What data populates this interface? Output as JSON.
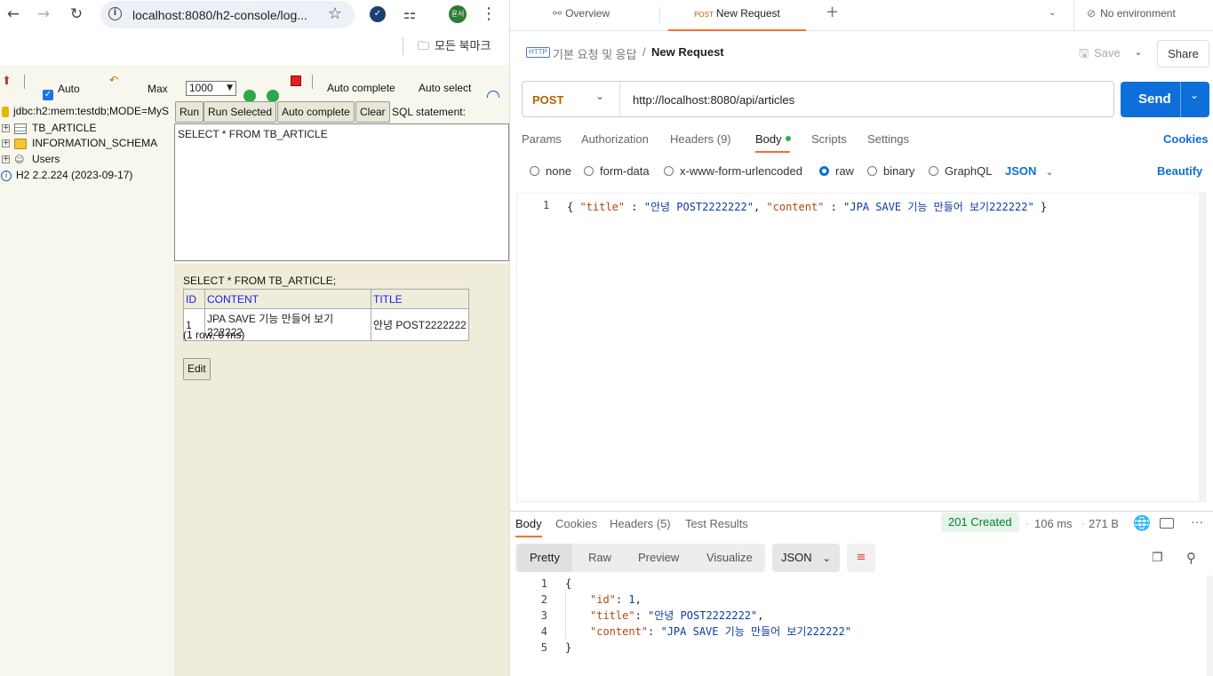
{
  "browser": {
    "url": "localhost:8080/h2-console/log...",
    "profile_initial": "윤서",
    "bookmarks_label": "모든 북마크"
  },
  "h2": {
    "toolbar": {
      "auto_commit_label": "Auto",
      "max_rows_label": "Max",
      "max_rows_value": "1000",
      "auto_complete_label": "Auto complete",
      "auto_select_label": "Auto select"
    },
    "connection": "jdbc:h2:mem:testdb;MODE=MyS",
    "tree": [
      {
        "label": "TB_ARTICLE"
      },
      {
        "label": "INFORMATION_SCHEMA"
      },
      {
        "label": "Users"
      }
    ],
    "version": "H2 2.2.224 (2023-09-17)",
    "buttons": {
      "run": "Run",
      "run_selected": "Run Selected",
      "auto_complete": "Auto complete",
      "clear": "Clear",
      "sql_label": "SQL statement:"
    },
    "sql": "SELECT * FROM TB_ARTICLE",
    "result": {
      "query": "SELECT * FROM TB_ARTICLE;",
      "columns": [
        "ID",
        "CONTENT",
        "TITLE"
      ],
      "rows": [
        [
          "1",
          "JPA SAVE 기능 만들어 보기222222",
          "안녕 POST2222222"
        ]
      ],
      "summary": "(1 row, 0 ms)",
      "edit_label": "Edit"
    }
  },
  "postman": {
    "tabs": {
      "overview": "Overview",
      "request_method": "POST",
      "request_name": "New Request",
      "environment": "No environment"
    },
    "breadcrumb": {
      "collection": "기본 요청 및 응답",
      "separator": "/",
      "request": "New Request",
      "save": "Save",
      "share": "Share"
    },
    "request": {
      "method": "POST",
      "url": "http://localhost:8080/api/articles",
      "send": "Send"
    },
    "param_tabs": {
      "params": "Params",
      "authorization": "Authorization",
      "headers": "Headers (9)",
      "body": "Body",
      "scripts": "Scripts",
      "settings": "Settings",
      "cookies": "Cookies"
    },
    "body_types": {
      "none": "none",
      "form_data": "form-data",
      "urlencoded": "x-www-form-urlencoded",
      "raw": "raw",
      "binary": "binary",
      "graphql": "GraphQL",
      "format": "JSON",
      "beautify": "Beautify"
    },
    "request_body": {
      "line": "1",
      "p1": "{ ",
      "k1": "\"title\"",
      "c1": " : ",
      "v1": "\"안녕 POST2222222\"",
      "c2": ", ",
      "k2": "\"content\"",
      "c3": " : ",
      "v2": "\"JPA SAVE 기능 만들어 보기222222\"",
      "p2": " }"
    },
    "response": {
      "tabs": {
        "body": "Body",
        "cookies": "Cookies",
        "headers": "Headers (5)",
        "test_results": "Test Results"
      },
      "status": "201 Created",
      "time": "106 ms",
      "size": "271 B",
      "views": {
        "pretty": "Pretty",
        "raw": "Raw",
        "preview": "Preview",
        "visualize": "Visualize",
        "format": "JSON"
      },
      "lines": [
        {
          "num": "1",
          "key": "",
          "val": "",
          "text": "{"
        },
        {
          "num": "2",
          "key": "\"id\"",
          "val": "1",
          "text": ","
        },
        {
          "num": "3",
          "key": "\"title\"",
          "val": "\"안녕 POST2222222\"",
          "text": ","
        },
        {
          "num": "4",
          "key": "\"content\"",
          "val": "\"JPA SAVE 기능 만들어 보기222222\"",
          "text": ""
        },
        {
          "num": "5",
          "key": "",
          "val": "",
          "text": "}"
        }
      ]
    }
  },
  "colors": {
    "post_orange": "#b26400",
    "send_blue": "#0e6fda",
    "status_green": "#007f31",
    "string_blue": "#0b3aa3",
    "key_orange": "#b5460d"
  }
}
